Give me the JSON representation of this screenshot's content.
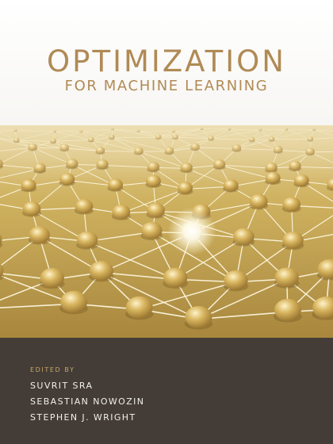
{
  "cover": {
    "title": "OPTIMIZATION",
    "subtitle": "FOR MACHINE LEARNING",
    "edited_by_label": "EDITED BY",
    "editors": [
      "SUVRIT SRA",
      "SEBASTIAN NOWOZIN",
      "STEPHEN J. WRIGHT"
    ]
  },
  "colors": {
    "title_gold": "#b08a55",
    "panel_background": "#433c37",
    "editor_text": "#f2efea",
    "edited_label": "#c8a764",
    "network_gold": "#cfad52"
  }
}
